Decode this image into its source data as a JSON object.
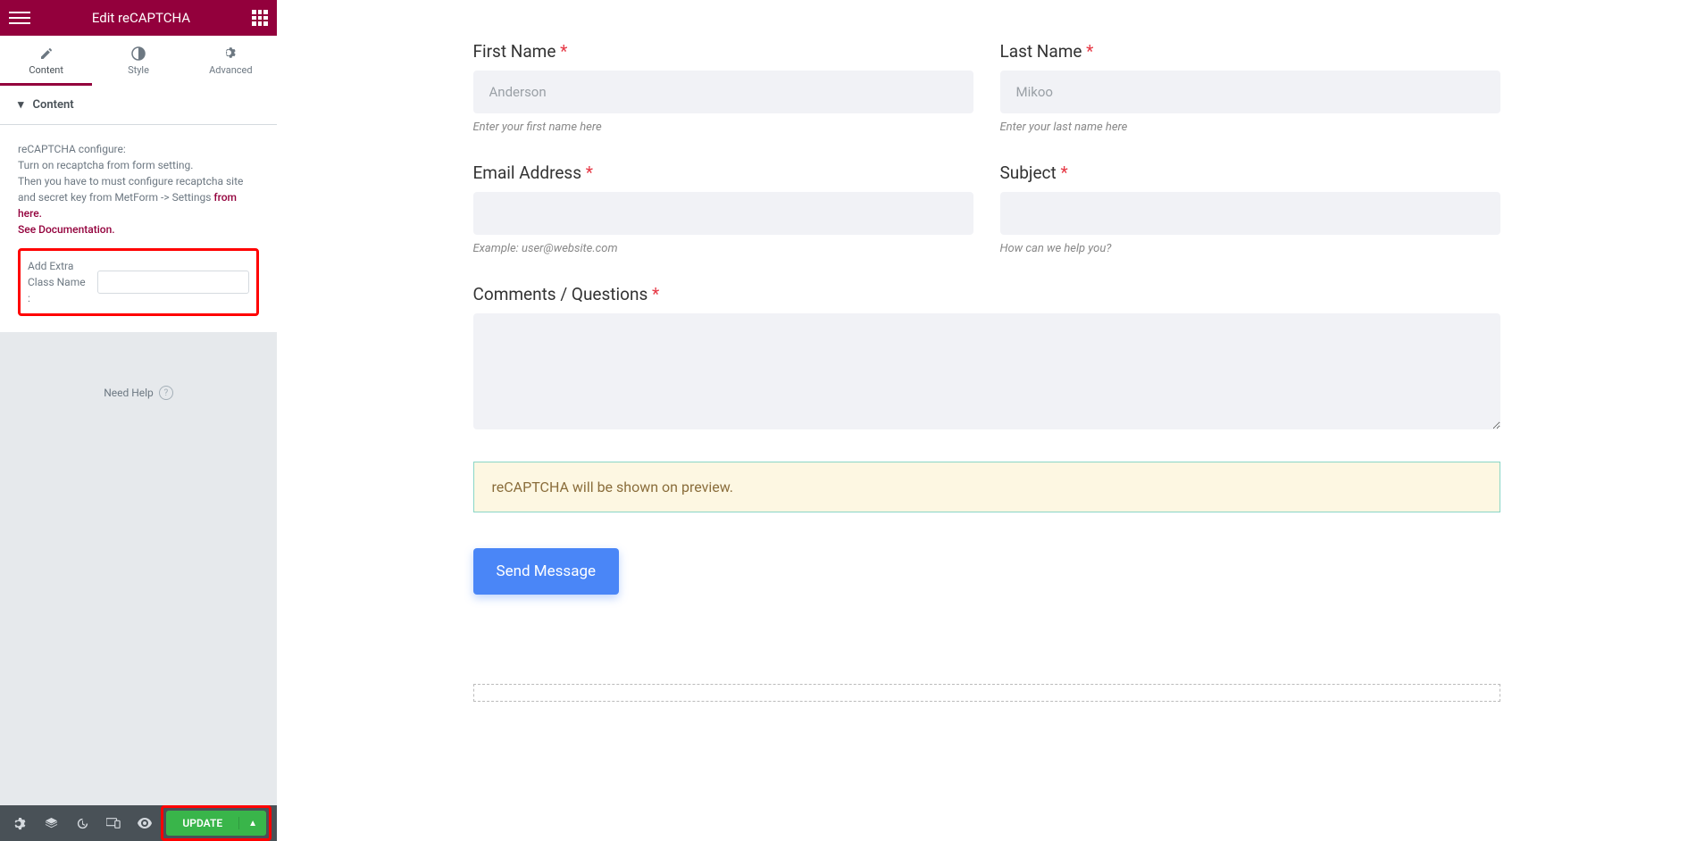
{
  "sidebar": {
    "title": "Edit reCAPTCHA",
    "tabs": {
      "content": "Content",
      "style": "Style",
      "advanced": "Advanced"
    },
    "section": {
      "header": "Content",
      "configure_line1": "reCAPTCHA configure:",
      "configure_line2": "Turn on recaptcha from form setting.",
      "configure_line3": "Then you have to must configure recaptcha site and secret key from MetForm -> Settings ",
      "from_here": "from here.",
      "see_doc": "See Documentation.",
      "extra_class_label": "Add Extra Class Name :"
    },
    "need_help": "Need Help",
    "footer": {
      "update": "UPDATE"
    }
  },
  "form": {
    "first_name": {
      "label": "First Name",
      "placeholder": "Anderson",
      "help": "Enter your first name here"
    },
    "last_name": {
      "label": "Last Name",
      "placeholder": "Mikoo",
      "help": "Enter your last name here"
    },
    "email": {
      "label": "Email Address",
      "help": "Example: user@website.com"
    },
    "subject": {
      "label": "Subject",
      "help": "How can we help you?"
    },
    "comments": {
      "label": "Comments / Questions"
    },
    "recaptcha_notice": "reCAPTCHA will be shown on preview.",
    "submit": "Send Message"
  }
}
